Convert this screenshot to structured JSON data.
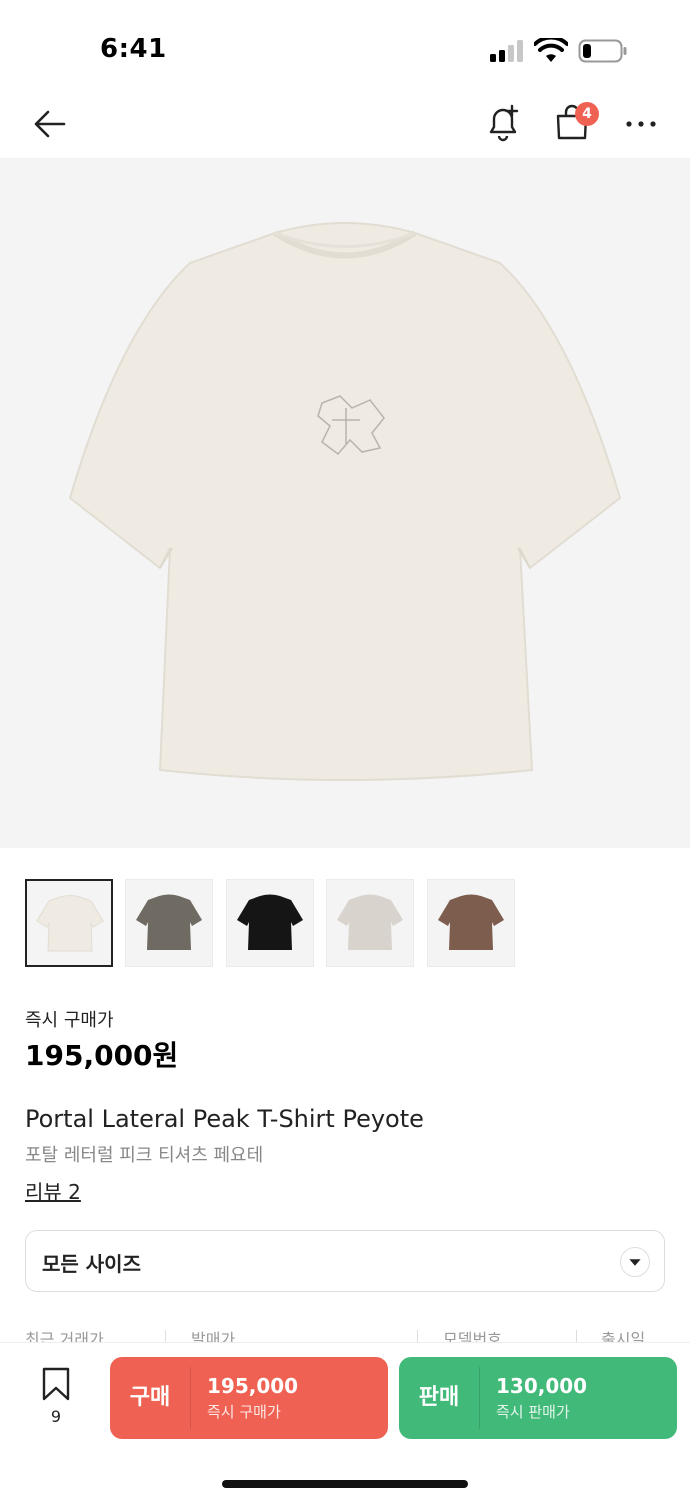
{
  "status_bar": {
    "time": "6:41"
  },
  "nav": {
    "cart_badge": "4"
  },
  "thumbnails": [
    {
      "color": "#efebe3"
    },
    {
      "color": "#6f6a62"
    },
    {
      "color": "#151515"
    },
    {
      "color": "#d8d3cd"
    },
    {
      "color": "#7d5d4d"
    }
  ],
  "product": {
    "price_label": "즉시 구매가",
    "price": "195,000원",
    "name_en": "Portal Lateral Peak T-Shirt Peyote",
    "name_ko": "포탈 레터럴 피크 티셔츠 페요테",
    "review_link": "리뷰 2"
  },
  "size_select": {
    "label": "모든 사이즈"
  },
  "info_header": {
    "recent": "최근 거래가",
    "release_price": "발매가",
    "model_no": "모델번호",
    "release_date": "출시일"
  },
  "bottom_bar": {
    "wish_count": "9",
    "buy": {
      "kind": "구매",
      "amount": "195,000",
      "sub": "즉시 구매가",
      "color": "#ef6253"
    },
    "sell": {
      "kind": "판매",
      "amount": "130,000",
      "sub": "즉시 판매가",
      "color": "#41b979"
    }
  }
}
